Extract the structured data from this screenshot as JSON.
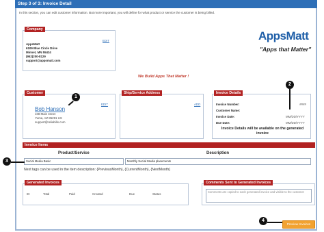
{
  "header": {
    "step_title": "Step 3 of 3: Invoice Detail",
    "intro": "In this section, you can edit customer information. But more important, you will define for what product or service the customer is being billed."
  },
  "company": {
    "tag": "Company",
    "edit": "EDIT",
    "lines": [
      "AppsMatt",
      "6109 Blue Circle Drive",
      "Minnet, MN 55424",
      "(952)200-8129",
      "support@appsmatt.com"
    ]
  },
  "logo": {
    "brand": "AppsMatt",
    "tagline": "\"Apps that Matter\""
  },
  "slogan": "We Build Apps That Matter !",
  "customer": {
    "tag": "Customer",
    "edit": "EDIT",
    "name": "Bob Hanson",
    "lines": [
      "108 Main street",
      "Yuma, AZ 85291 US",
      "support@reliabilis.com"
    ]
  },
  "ship": {
    "tag": "Ship/Service Address",
    "add": "ADD"
  },
  "invoice_details": {
    "tag": "Invoice Details",
    "rows": [
      {
        "label": "Invoice Number:",
        "value": "####"
      },
      {
        "label": "Customer Name:",
        "value": ""
      },
      {
        "label": "Invoice Date:",
        "value": "MM/DD/YYYY"
      },
      {
        "label": "Due Date:",
        "value": "MM/DD/YYYY"
      }
    ],
    "note": "Invoice Details will be available on the generated invoice"
  },
  "invoice_items": {
    "bar": "Invoice Items",
    "col_product": "Product/Service",
    "col_description": "Description",
    "product_value": "Social Media Basic",
    "description_value": "Monthly Social Media placements",
    "tags_note": "Next tags can be used in the item description: {PreviousMonth}, {CurrentMonth}, {NextMonth}"
  },
  "generated": {
    "tag": "Generated Invoices",
    "columns": [
      "ID",
      "Total",
      "Paid",
      "Created",
      "Due",
      "Status"
    ]
  },
  "comments": {
    "tag": "Comments Sent to Generated Invoices",
    "placeholder": "Comments are copied to each generated invoice and visible to the customer"
  },
  "preview_button": "Preview Invoices",
  "callouts": [
    "1",
    "2",
    "3",
    "4"
  ],
  "colors": {
    "header_blue": "#2e6fb7",
    "tag_red": "#b22222",
    "button_orange": "#f2a230"
  }
}
